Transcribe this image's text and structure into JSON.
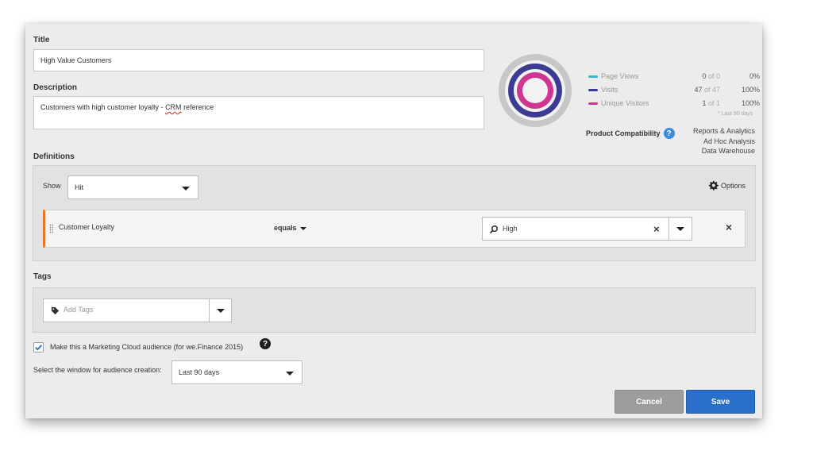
{
  "form": {
    "title_label": "Title",
    "title_value": "High Value Customers",
    "description_label": "Description",
    "description_prefix": "Customers with high customer loyalty - ",
    "description_crm": "CRM",
    "description_suffix": " reference"
  },
  "summary": {
    "rows": [
      {
        "name": "Page Views",
        "count": "0",
        "of": "of 0",
        "pct": "0%",
        "color": "#38b6d8"
      },
      {
        "name": "Visits",
        "count": "47",
        "of": "of 47",
        "pct": "100%",
        "color": "#3c3c94"
      },
      {
        "name": "Unique Visitors",
        "count": "1",
        "of": "of 1",
        "pct": "100%",
        "color": "#d0358f"
      }
    ],
    "last_days": "* Last 90 days",
    "compatibility_label": "Product Compatibility",
    "compatibility_items": [
      "Reports & Analytics",
      "Ad Hoc Analysis",
      "Data Warehouse"
    ]
  },
  "definitions": {
    "section_label": "Definitions",
    "show_label": "Show",
    "show_value": "Hit",
    "options_label": "Options",
    "rule": {
      "dimension": "Customer Loyalty",
      "operator": "equals",
      "value": "High"
    }
  },
  "tags": {
    "section_label": "Tags",
    "placeholder": "Add Tags"
  },
  "audience": {
    "checkbox_label": "Make this a Marketing Cloud audience (for we.Finance 2015)",
    "checked": true,
    "window_label": "Select the window for audience creation:",
    "window_value": "Last 90 days"
  },
  "actions": {
    "cancel": "Cancel",
    "save": "Save"
  },
  "colors": {
    "accent_blue": "#2a6fc9",
    "rule_accent": "#e8742a"
  }
}
